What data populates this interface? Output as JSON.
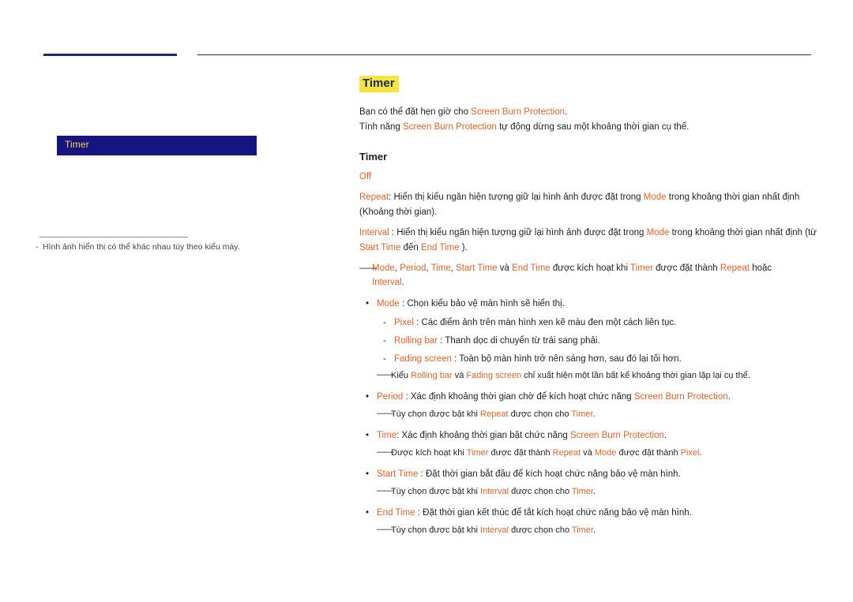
{
  "left": {
    "menu_item": "Timer",
    "footnote_dash": "-",
    "footnote": "Hình ảnh hiển thị có thể khác nhau tùy theo kiểu máy."
  },
  "content": {
    "title": "Timer",
    "intro_line1_a": "Bạn có thể đặt hẹn giờ cho ",
    "intro_line1_b": "Screen Burn Protection",
    "intro_line1_c": ".",
    "intro_line2_a": "Tính năng ",
    "intro_line2_b": "Screen Burn Protection",
    "intro_line2_c": " tự động dừng sau một khoảng thời gian cụ thể.",
    "section_title": "Timer",
    "opt_off": "Off",
    "opt_repeat_name": "Repeat",
    "opt_repeat_text_a": ": Hiển thị kiểu ngăn hiện tượng giữ lại hình ảnh được đặt trong ",
    "opt_repeat_mode": "Mode",
    "opt_repeat_text_b": " trong khoảng thời gian nhất định",
    "opt_repeat_text_c": "(Khoảng thời gian).",
    "opt_interval_name": "Interval",
    "opt_interval_text_a": " : Hiển thị kiểu ngăn hiện tượng giữ lại hình ảnh được đặt trong ",
    "opt_interval_mode": "Mode",
    "opt_interval_text_b": " trong khoảng thời gian nhất định (từ",
    "opt_interval_start": "Start Time",
    "opt_interval_text_c": " đến ",
    "opt_interval_end": "End Time",
    "opt_interval_text_d": " ).",
    "note1_a": "Mode",
    "note1_b": ", ",
    "note1_c": "Period",
    "note1_d": ", ",
    "note1_e": "Time",
    "note1_f": ", ",
    "note1_g": "Start Time",
    "note1_h": " và ",
    "note1_i": "End Time",
    "note1_j": " được kích hoạt khi ",
    "note1_k": "Timer",
    "note1_l": " được đặt thành ",
    "note1_m": "Repeat",
    "note1_n": " hoặc",
    "note1_o": "Interval",
    "note1_p": ".",
    "b_mode_name": "Mode",
    "b_mode_text": " : Chọn kiểu bảo vệ màn hình sẽ hiển thị.",
    "sb_pixel_name": "Pixel",
    "sb_pixel_text": " : Các điểm ảnh trên màn hình xen kẽ màu đen một cách liên tục.",
    "sb_rolling_name": "Rolling bar",
    "sb_rolling_text": " : Thanh dọc di chuyển từ trái sang phải.",
    "sb_fading_name": "Fading screen",
    "sb_fading_text": " : Toàn bộ màn hình trở nên sáng hơn, sau đó lại tối hơn.",
    "note2_a": "Kiểu ",
    "note2_b": "Rolling bar",
    "note2_c": " và ",
    "note2_d": "Fading screen",
    "note2_e": " chỉ xuất hiện một lần bất kể khoảng thời gian lặp lại cụ thể.",
    "b_period_name": "Period",
    "b_period_text_a": " : Xác định khoảng thời gian chờ để kích hoạt chức năng ",
    "b_period_link": "Screen Burn Protection",
    "b_period_text_b": ".",
    "note3_a": "Tùy chọn được bật khi ",
    "note3_b": "Repeat",
    "note3_c": " được chọn cho ",
    "note3_d": "Timer",
    "note3_e": ".",
    "b_time_name": "Time",
    "b_time_text_a": ": Xác định khoảng thời gian bật chức năng ",
    "b_time_link": "Screen Burn Protection",
    "b_time_text_b": ".",
    "note4_a": "Được kích hoạt khi ",
    "note4_b": "Timer",
    "note4_c": " được đặt thành ",
    "note4_d": "Repeat",
    "note4_e": " và ",
    "note4_f": "Mode",
    "note4_g": " được đặt thành ",
    "note4_h": "Pixel",
    "note4_i": ".",
    "b_start_name": "Start Time",
    "b_start_text": " : Đặt thời gian bắt đầu để kích hoạt chức năng bảo vệ màn hình.",
    "note5_a": "Tùy chọn được bật khi ",
    "note5_b": "Interval",
    "note5_c": " được chọn cho ",
    "note5_d": "Timer",
    "note5_e": ".",
    "b_end_name": "End Time",
    "b_end_text": " : Đặt thời gian kết thúc để tắt kích hoạt chức năng bảo vệ màn hình.",
    "note6_a": "Tùy chọn được bật khi ",
    "note6_b": "Interval",
    "note6_c": " được chọn cho ",
    "note6_d": "Timer",
    "note6_e": ".",
    "bullet_glyph": "•",
    "dash_glyph": "-",
    "note_glyph": "――"
  },
  "colors": {
    "navy": "#1b2a6b",
    "menu_bg": "#14157f",
    "menu_text": "#ffd24a",
    "highlight": "#f5e53c",
    "orange": "#e8622a"
  }
}
